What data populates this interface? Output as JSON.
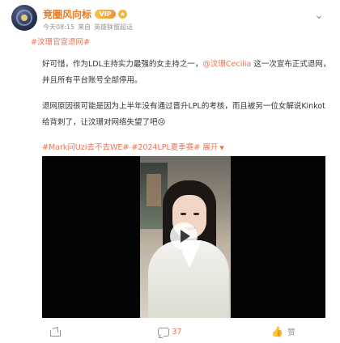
{
  "post": {
    "author": {
      "name": "竞圈风向标",
      "vip_badge": "VIP",
      "verified_icon": "star-verified-icon"
    },
    "meta": {
      "time": "今天08:15",
      "source_prefix": "来自",
      "source": "英雄联盟超话"
    },
    "topic": "#汶珊官宣退网#",
    "paragraph1": {
      "before": "好可惜，作为LDL主持实力最强的女主持之一，",
      "mention": "@汶珊Cecilia",
      "after": " 这一次宣布正式退网，并且所有平台账号全部停用。"
    },
    "paragraph2": "退网原因很可能是因为上半年没有通过晋升LPL的考核，而且被另一位女解说Kinkot给背刺了，让汶珊对网络失望了吧😢",
    "hashtags": {
      "tags": "#Mark问Uzi去不去WE# #2024LPL夏季赛#",
      "expand": "展开"
    },
    "video": {
      "play_icon": "play-icon"
    },
    "actions": {
      "share_count": "",
      "comment_count": "37",
      "like_count": "",
      "like_label": "赞"
    },
    "colors": {
      "accent": "#eb7350",
      "username": "#e8791f",
      "muted": "#939393"
    }
  }
}
